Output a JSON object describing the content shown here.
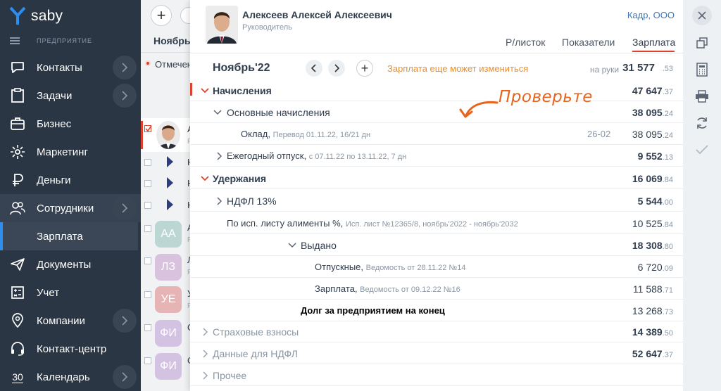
{
  "app": {
    "brand": "saby",
    "org_label": "ПРЕДПРИЯТИЕ"
  },
  "sidebar": {
    "items": [
      {
        "label": "Контакты",
        "icon": "chat-bubble-icon",
        "chevron": true
      },
      {
        "label": "Задачи",
        "icon": "tasks-icon",
        "chevron": true
      },
      {
        "label": "Бизнес",
        "icon": "briefcase-icon",
        "chevron": false
      },
      {
        "label": "Маркетинг",
        "icon": "marketing-icon",
        "chevron": false
      },
      {
        "label": "Деньги",
        "icon": "ruble-icon",
        "chevron": false
      },
      {
        "label": "Сотрудники",
        "icon": "employees-icon",
        "chevron": true
      },
      {
        "label": "Зарплата",
        "icon": "",
        "chevron": false
      },
      {
        "label": "Документы",
        "icon": "paper-plane-icon",
        "chevron": false
      },
      {
        "label": "Учет",
        "icon": "accounting-icon",
        "chevron": false
      },
      {
        "label": "Компании",
        "icon": "location-pin-icon",
        "chevron": true
      },
      {
        "label": "Контакт-центр",
        "icon": "headset-icon",
        "chevron": false
      },
      {
        "label": "Календарь",
        "icon": "calendar-icon",
        "chevron": true,
        "badge": "30"
      }
    ]
  },
  "middle": {
    "title": "Ноябрь'2",
    "mark_label": "Отмечен",
    "rows": [
      {
        "letter": "А",
        "sub": "Р"
      },
      {
        "letter": "Н"
      },
      {
        "letter": "Н"
      },
      {
        "letter": "Н"
      },
      {
        "initials": "АА",
        "letter": "А",
        "sub": "Р",
        "color": "#bcd6d3"
      },
      {
        "initials": "ЛЗ",
        "letter": "Л",
        "sub": "Р",
        "color": "#d8c2dd"
      },
      {
        "initials": "УЕ",
        "letter": "У",
        "sub": "Р",
        "color": "#e6b4b4"
      },
      {
        "initials": "ФИ",
        "letter": "О",
        "color": "#d4c2e2"
      },
      {
        "initials": "ФИ",
        "letter": "О",
        "color": "#d4c2e2"
      }
    ]
  },
  "employee": {
    "name": "Алексеев Алексей Алексеевич",
    "role": "Руководитель",
    "company": "Кадр, ООО"
  },
  "tabs": [
    "Р/листок",
    "Показатели",
    "Зарплата"
  ],
  "period": {
    "label": "Ноябрь'22",
    "warning": "Зарплата еще может измениться",
    "hand_label": "на руки",
    "hand_value": "31 577",
    "hand_kop": ".53"
  },
  "annotation": "Проверьте",
  "lines": [
    {
      "text": "Начисления",
      "amt": "47 647",
      "kop": ".37"
    },
    {
      "text": "Основные начисления",
      "amt": "38 095",
      "kop": ".24"
    },
    {
      "text": "Оклад,",
      "note": "Перевод 01.11.22, 16/21 дн",
      "code": "26-02",
      "amt": "38 095",
      "kop": ".24"
    },
    {
      "text": "Ежегодный отпуск,",
      "note": "с 07.11.22 по 13.11.22, 7 дн",
      "amt": "9 552",
      "kop": ".13"
    },
    {
      "text": "Удержания",
      "amt": "16 069",
      "kop": ".84"
    },
    {
      "text": "НДФЛ 13%",
      "amt": "5 544",
      "kop": ".00"
    },
    {
      "text": "По исп. листу алименты %,",
      "note": "Исп. лист №12365/8, ноябрь'2022 - ноябрь'2032",
      "amt": "10 525",
      "kop": ".84"
    },
    {
      "text": "Выдано",
      "amt": "18 308",
      "kop": ".80"
    },
    {
      "text": "Отпускные,",
      "note": "Ведомость от 28.11.22 №14",
      "amt": "6 720",
      "kop": ".09"
    },
    {
      "text": "Зарплата,",
      "note": "Ведомость от 09.12.22 №16",
      "amt": "11 588",
      "kop": ".71"
    },
    {
      "text": "Долг за предприятием на конец",
      "amt": "13 268",
      "kop": ".73"
    },
    {
      "text": "Страховые взносы",
      "amt": "14 389",
      "kop": ".50"
    },
    {
      "text": "Данные для НДФЛ",
      "amt": "52 647",
      "kop": ".37"
    },
    {
      "text": "Прочее"
    }
  ],
  "colors": {
    "accent": "#e0412c",
    "sidebar": "#2b3644",
    "link": "#3f78b6",
    "warning": "#e88f2f"
  }
}
